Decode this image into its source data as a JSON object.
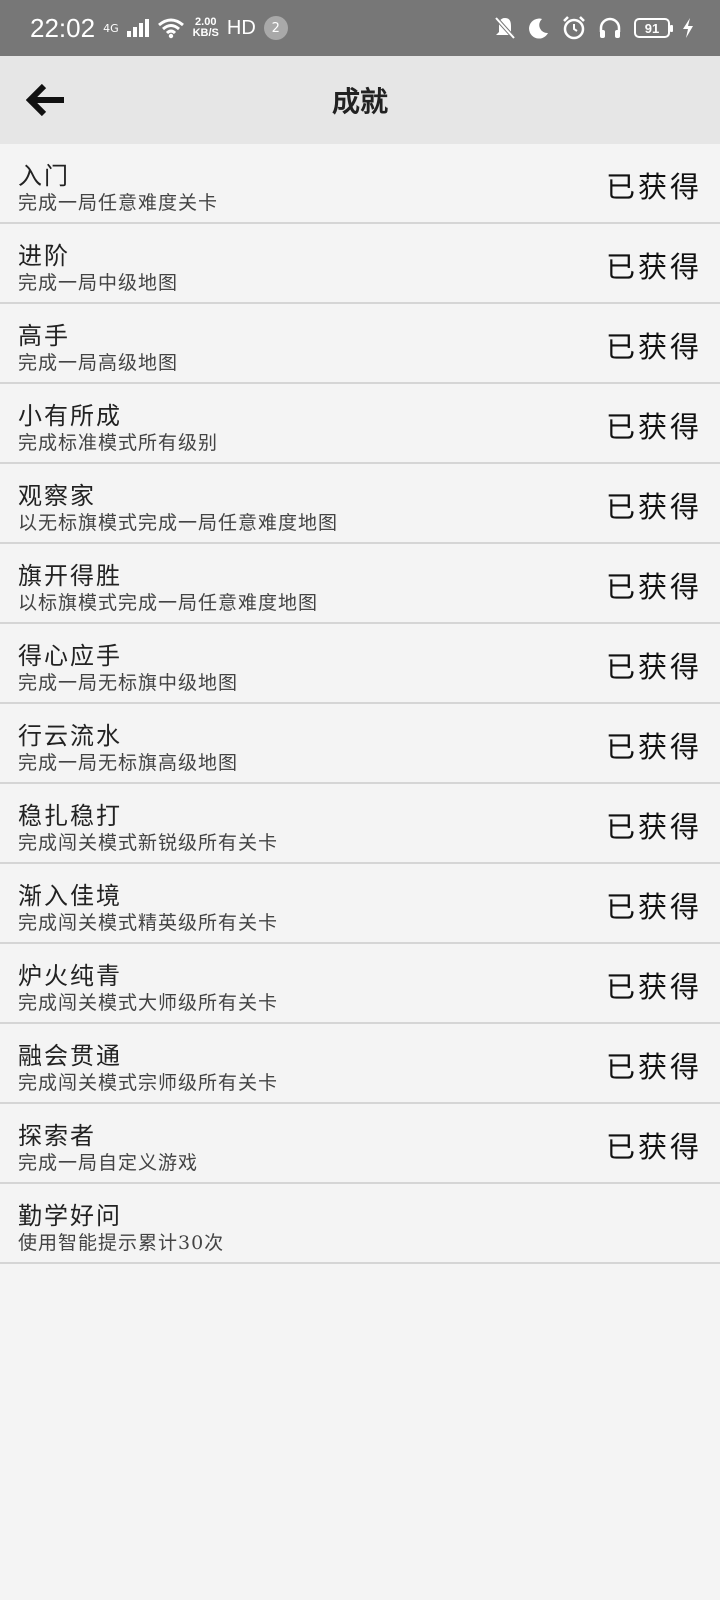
{
  "status_bar": {
    "time": "22:02",
    "network": "4G",
    "speed_value": "2.00",
    "speed_unit": "KB/S",
    "hd": "HD",
    "notification_count": "2",
    "battery": "91",
    "icons": [
      "signal-icon",
      "wifi-icon",
      "mute-icon",
      "moon-icon",
      "alarm-icon",
      "headset-icon",
      "battery-icon",
      "charging-icon"
    ]
  },
  "header": {
    "title": "成就",
    "back_icon": "arrow-left-icon"
  },
  "achievements": [
    {
      "title": "入门",
      "desc": "完成一局任意难度关卡",
      "status": "已获得"
    },
    {
      "title": "进阶",
      "desc": "完成一局中级地图",
      "status": "已获得"
    },
    {
      "title": "高手",
      "desc": "完成一局高级地图",
      "status": "已获得"
    },
    {
      "title": "小有所成",
      "desc": "完成标准模式所有级别",
      "status": "已获得"
    },
    {
      "title": "观察家",
      "desc": "以无标旗模式完成一局任意难度地图",
      "status": "已获得"
    },
    {
      "title": "旗开得胜",
      "desc": "以标旗模式完成一局任意难度地图",
      "status": "已获得"
    },
    {
      "title": "得心应手",
      "desc": "完成一局无标旗中级地图",
      "status": "已获得"
    },
    {
      "title": "行云流水",
      "desc": "完成一局无标旗高级地图",
      "status": "已获得"
    },
    {
      "title": "稳扎稳打",
      "desc": "完成闯关模式新锐级所有关卡",
      "status": "已获得"
    },
    {
      "title": "渐入佳境",
      "desc": "完成闯关模式精英级所有关卡",
      "status": "已获得"
    },
    {
      "title": "炉火纯青",
      "desc": "完成闯关模式大师级所有关卡",
      "status": "已获得"
    },
    {
      "title": "融会贯通",
      "desc": "完成闯关模式宗师级所有关卡",
      "status": "已获得"
    },
    {
      "title": "探索者",
      "desc": "完成一局自定义游戏",
      "status": "已获得"
    },
    {
      "title": "勤学好问",
      "desc": "使用智能提示累计30次",
      "status": ""
    }
  ]
}
